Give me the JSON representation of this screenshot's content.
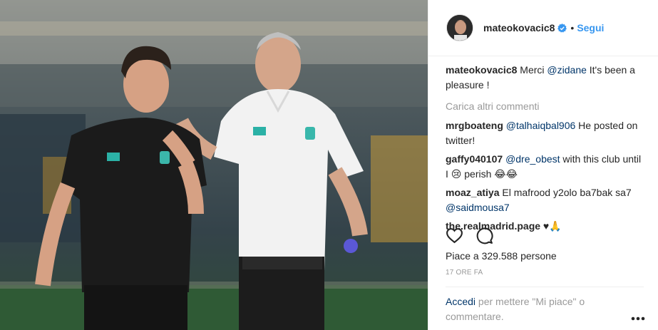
{
  "post": {
    "username": "mateokovacic8",
    "separator": "•",
    "follow_label": "Segui",
    "caption_user": "mateokovacic8",
    "caption_pre": "Merci ",
    "caption_mention": "@zidane",
    "caption_post": " It's been a pleasure !",
    "load_more": "Carica altri commenti",
    "likes": "Piace a 329.588 persone",
    "time": "17 ORE FA",
    "login_link": "Accedi",
    "login_text": " per mettere \"Mi piace\" o commentare."
  },
  "comments": [
    {
      "user": "mrgboateng",
      "mention": "@talhaiqbal906",
      "text": " He posted on twitter!"
    },
    {
      "user": "gaffy040107",
      "mention": "@dre_obest",
      "text": " with this club until I 😢 perish 😂😂"
    },
    {
      "user": "moaz_atiya",
      "mention": "",
      "text": "El mafrood y2olo ba7bak sa7 ",
      "mention2": "@saidmousa7"
    },
    {
      "user": "the.realmadrid.page",
      "mention": "",
      "text": " ♥🙏"
    }
  ],
  "colors": {
    "link": "#3897f0",
    "mention": "#003569",
    "muted": "#999999",
    "text": "#262626"
  },
  "icons": [
    "verified-badge-icon",
    "heart-icon",
    "comment-icon",
    "more-options-icon"
  ]
}
